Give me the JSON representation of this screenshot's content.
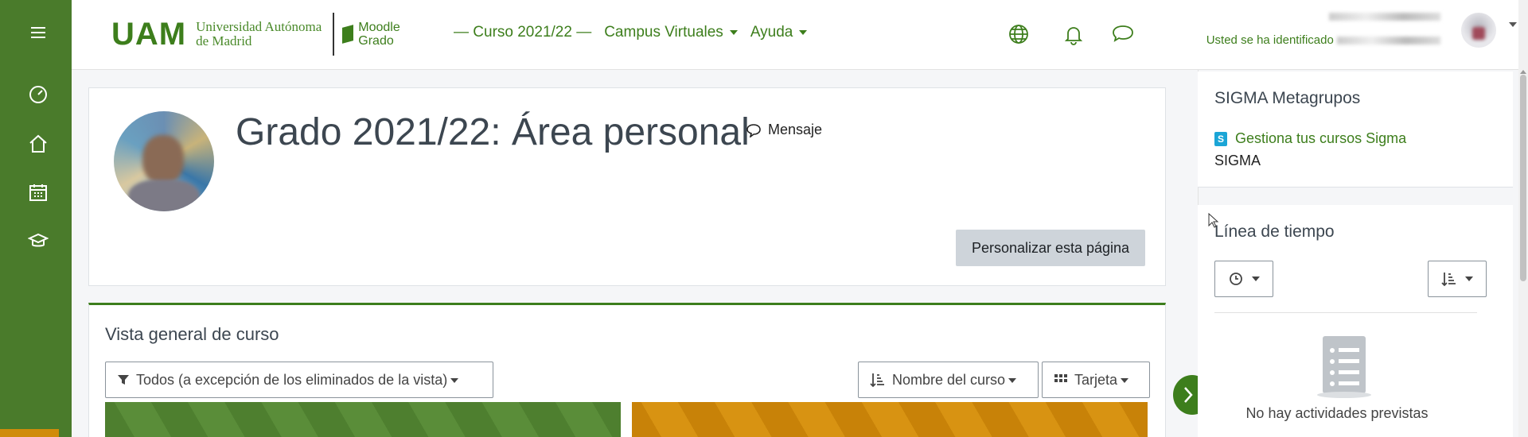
{
  "topbar": {
    "logo_uam": "UAM",
    "logo_uni_line1": "Universidad Autónoma",
    "logo_uni_line2": "de Madrid",
    "logo_moodle_line1": "Moodle",
    "logo_moodle_line2": "Grado",
    "nav": [
      "— Curso 2021/22 —",
      "Campus Virtuales",
      "Ayuda"
    ],
    "user_label": "Usted se ha identificado"
  },
  "rail": {
    "icons": [
      "menu-icon",
      "dashboard-icon",
      "home-icon",
      "calendar-icon",
      "courses-icon"
    ]
  },
  "header": {
    "title": "Grado 2021/22: Área personal",
    "message_label": "Mensaje",
    "customize_button": "Personalizar esta página"
  },
  "overview": {
    "title": "Vista general de curso",
    "filter_label": "Todos (a excepción de los eliminados de la vista)",
    "sort_label": "Nombre del curso",
    "view_label": "Tarjeta"
  },
  "right": {
    "sigma_title": "SIGMA Metagrupos",
    "sigma_link": "Gestiona tus cursos Sigma",
    "sigma_text": "SIGMA",
    "timeline_title": "Línea de tiempo",
    "no_activities": "No hay actividades previstas"
  },
  "colors": {
    "brand_green": "#3d7e1c",
    "rail_green": "#4a7b2b",
    "accent_orange": "#d08c0b"
  }
}
